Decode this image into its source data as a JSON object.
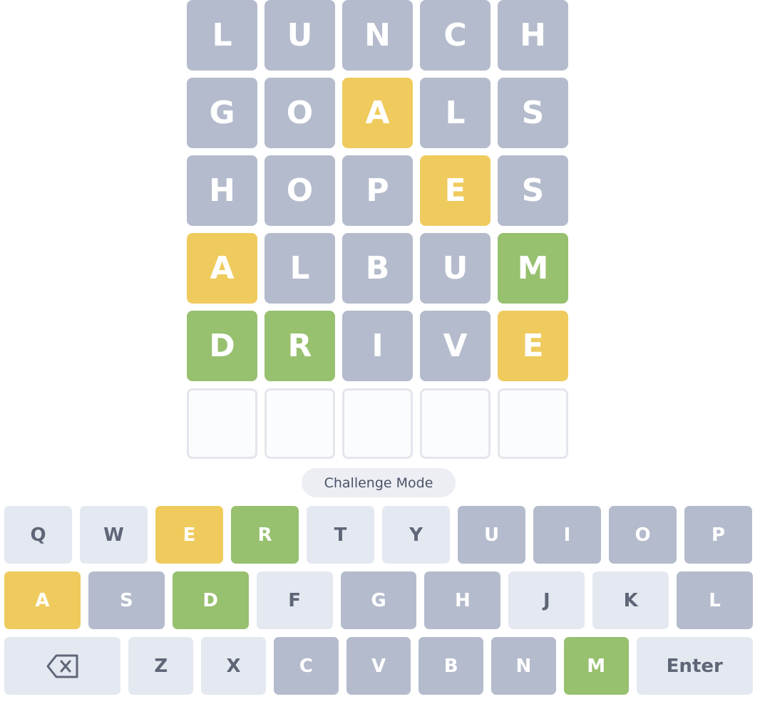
{
  "board": {
    "rows": [
      {
        "tiles": [
          {
            "letter": "L",
            "state": "absent"
          },
          {
            "letter": "U",
            "state": "absent"
          },
          {
            "letter": "N",
            "state": "absent"
          },
          {
            "letter": "C",
            "state": "absent"
          },
          {
            "letter": "H",
            "state": "absent"
          }
        ]
      },
      {
        "tiles": [
          {
            "letter": "G",
            "state": "absent"
          },
          {
            "letter": "O",
            "state": "absent"
          },
          {
            "letter": "A",
            "state": "present"
          },
          {
            "letter": "L",
            "state": "absent"
          },
          {
            "letter": "S",
            "state": "absent"
          }
        ]
      },
      {
        "tiles": [
          {
            "letter": "H",
            "state": "absent"
          },
          {
            "letter": "O",
            "state": "absent"
          },
          {
            "letter": "P",
            "state": "absent"
          },
          {
            "letter": "E",
            "state": "present"
          },
          {
            "letter": "S",
            "state": "absent"
          }
        ]
      },
      {
        "tiles": [
          {
            "letter": "A",
            "state": "present"
          },
          {
            "letter": "L",
            "state": "absent"
          },
          {
            "letter": "B",
            "state": "absent"
          },
          {
            "letter": "U",
            "state": "absent"
          },
          {
            "letter": "M",
            "state": "correct"
          }
        ]
      },
      {
        "tiles": [
          {
            "letter": "D",
            "state": "correct"
          },
          {
            "letter": "R",
            "state": "correct"
          },
          {
            "letter": "I",
            "state": "absent"
          },
          {
            "letter": "V",
            "state": "absent"
          },
          {
            "letter": "E",
            "state": "present"
          }
        ]
      },
      {
        "tiles": [
          {
            "letter": "",
            "state": "empty"
          },
          {
            "letter": "",
            "state": "empty"
          },
          {
            "letter": "",
            "state": "empty"
          },
          {
            "letter": "",
            "state": "empty"
          },
          {
            "letter": "",
            "state": "empty"
          }
        ]
      }
    ]
  },
  "mode": {
    "label": "Challenge Mode"
  },
  "keyboard": {
    "rows": [
      [
        {
          "label": "Q",
          "state": "unused"
        },
        {
          "label": "W",
          "state": "unused"
        },
        {
          "label": "E",
          "state": "present"
        },
        {
          "label": "R",
          "state": "correct"
        },
        {
          "label": "T",
          "state": "unused"
        },
        {
          "label": "Y",
          "state": "unused"
        },
        {
          "label": "U",
          "state": "absent"
        },
        {
          "label": "I",
          "state": "absent"
        },
        {
          "label": "O",
          "state": "absent"
        },
        {
          "label": "P",
          "state": "absent"
        }
      ],
      [
        {
          "label": "A",
          "state": "present"
        },
        {
          "label": "S",
          "state": "absent"
        },
        {
          "label": "D",
          "state": "correct"
        },
        {
          "label": "F",
          "state": "unused"
        },
        {
          "label": "G",
          "state": "absent"
        },
        {
          "label": "H",
          "state": "absent"
        },
        {
          "label": "J",
          "state": "unused"
        },
        {
          "label": "K",
          "state": "unused"
        },
        {
          "label": "L",
          "state": "absent"
        }
      ],
      [
        {
          "label": "",
          "icon": "backspace-icon",
          "state": "unused",
          "wide": true
        },
        {
          "label": "Z",
          "state": "unused"
        },
        {
          "label": "X",
          "state": "unused"
        },
        {
          "label": "C",
          "state": "absent"
        },
        {
          "label": "V",
          "state": "absent"
        },
        {
          "label": "B",
          "state": "absent"
        },
        {
          "label": "N",
          "state": "absent"
        },
        {
          "label": "M",
          "state": "correct"
        },
        {
          "label": "Enter",
          "state": "unused",
          "wide": true
        }
      ]
    ]
  },
  "colors": {
    "absent": "#b4bbcc",
    "present": "#efcb5e",
    "correct": "#97c06f",
    "unused_key": "#e4e8f0",
    "empty_tile_border": "#e3e6ec"
  }
}
